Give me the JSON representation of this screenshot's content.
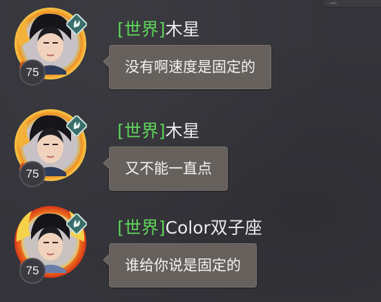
{
  "messages": [
    {
      "level": "75",
      "channel": "[世界]",
      "sender": "木星",
      "text": "没有啊速度是固定的"
    },
    {
      "level": "75",
      "channel": "[世界]",
      "sender": "木星",
      "text": "又不能一直点"
    },
    {
      "level": "75",
      "channel": "[世界]",
      "sender": "Color双子座",
      "text": "谁给你说是固定的"
    }
  ],
  "colors": {
    "channel": "#5fd35a",
    "sender": "#ececec",
    "bubble": "#66615c",
    "background": "#34343a"
  },
  "icons": {
    "avatar_frame": "golden-dragon-frame-icon",
    "badge": "jade-rabbit-badge-icon"
  }
}
